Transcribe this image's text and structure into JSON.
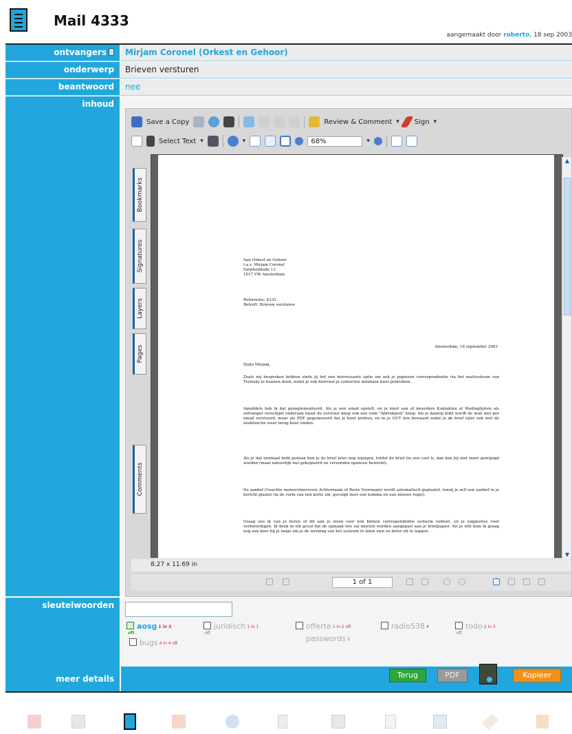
{
  "header": {
    "title": "Mail 4333",
    "meta_prefix": "aangemaakt door ",
    "meta_user": "roberto",
    "meta_suffix": ", 18 sep 2003"
  },
  "fields": {
    "ontvangers_label": "ontvangers",
    "ontvangers_value": "Mirjam Coronel (Orkest en Gehoor)",
    "onderwerp_label": "onderwerp",
    "onderwerp_value": "Brieven versturen",
    "beantwoord_label": "beantwoord",
    "beantwoord_value": "nee",
    "inhoud_label": "inhoud",
    "sleutelwoorden_label": "sleutelwoorden",
    "meer_details_label": "meer details"
  },
  "viewer": {
    "toolbar1": {
      "save_copy": "Save a Copy",
      "review_comment": "Review & Comment",
      "sign": "Sign"
    },
    "toolbar2": {
      "select_text": "Select Text",
      "zoom": "68%"
    },
    "side_tabs": [
      "Bookmarks",
      "Signatures",
      "Layers",
      "Pages",
      "Comments"
    ],
    "page_size": "8.27 x 11.69 in",
    "page_count": "1 of 1"
  },
  "letter": {
    "address": [
      "Aan Orkest en Gehoor",
      "t.a.v. Mirjam Coronel",
      "Sarphatikade 13",
      "1017 VW Amsterdam"
    ],
    "reference": "Referentie: 4333",
    "subject": "Betreft: Brieven versturen",
    "date": "Amsterdam, 18 september 2003",
    "greeting": "Hallo Mirjam,",
    "paragraphs": [
      "Zoals wij besproken hebben sinds jij het een interessante optie om ook je papieren correspondentie via het mailsysteem van Tisotelis te kunnen doen, zodat je ook hiervoor je contacten database kunt gebruiken.",
      "Inmiddels heb ik dat geimplementeerd. Als je een email opstelt, en je kiest een of meerdere Kontakten of Mailinglijsten als ontvanger verschijnt onderaan naast de verstuur knop ook een rode \"Afdrukpost\" knop. Als je daarop klikt wordt de mail niet per email verstuurd, maar als PDF gegenereerd dat je kunt printen, en in je OUT box bewaard zodat je de brief later ook met de zoekfunctie weer terug kunt vinden.",
      "Als je dat eenmaal hebt gedaan kun je de brief later nog wijzigen, totdat de brief (in een cool is, dan kan hij niet meer gewijzigd worden (maar natuurlijk wel gekopieerd en verzonden opnieuw bewerkt).",
      "De aanhef (Geachte meneer/mevrouw Achternaam of Beste Voornaam) wordt automatisch geplaatst, tenzij je zelf een aanhef in je bericht plaatst (in de vorm van een korte zin, gevolgd door een komma en een nieuwe regel).",
      "Graag zou ik van je horen of dit aan je eisen voor een binnen correspondentie systeem voldoet, en je suggesties voor verbeteringen. Ik denk in elk geval dat de opmaak iets zal moeten worden aangepast aan je briefpapier. Als je wilt kom ik graag nog een keer bij je langs om je de werking van het systeem te laten zien en beter uit te leggen."
    ]
  },
  "keywords": [
    {
      "label": "aosg",
      "count": "1 in 3",
      "sub": "oft",
      "checked": true
    },
    {
      "label": "juridisch",
      "count": "1 in 1",
      "sub": "oft",
      "checked": false
    },
    {
      "label": "offerte",
      "count": "1 in 2 oft",
      "sub": "",
      "checked": false
    },
    {
      "label": "radio538",
      "count": "4",
      "sub": "",
      "checked": false
    },
    {
      "label": "todo",
      "count": "2 in 3",
      "sub": "oft",
      "checked": false
    },
    {
      "label": "bugs",
      "count": "4 in 4 oft",
      "sub": "",
      "checked": false
    },
    {
      "label": "passwords",
      "count": "1",
      "sub": "",
      "checked": false
    }
  ],
  "buttons": {
    "terug": "Terug",
    "pdf": "PDF",
    "kopieer": "Kopieer"
  },
  "dock": [
    "grid-icon",
    "table-icon",
    "document-icon",
    "calendar-icon",
    "paperclip-icon",
    "phone-icon",
    "stack-icon",
    "note-icon",
    "calendar-24-icon",
    "tag-icon",
    "logout-icon"
  ],
  "colors": {
    "accent": "#21a7dd",
    "label_text": "#ffffff",
    "terug_green": "#2fa63c",
    "kopieer_orange": "#f0901a"
  }
}
